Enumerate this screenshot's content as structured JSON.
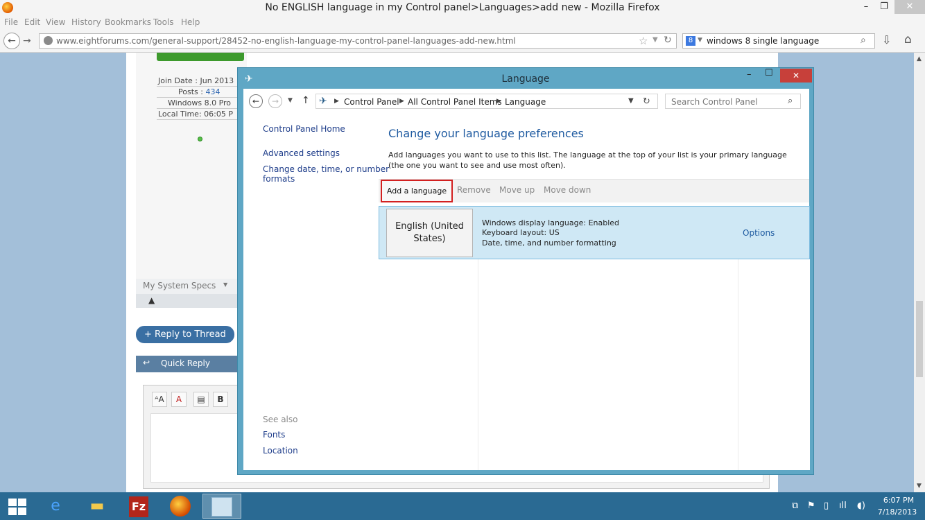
{
  "browser": {
    "title": "No ENGLISH language in my Control panel>Languages>add new - Mozilla Firefox",
    "controls": {
      "minimize": "–",
      "maximize": "❐",
      "close": "✕"
    },
    "menu": [
      "File",
      "Edit",
      "View",
      "History",
      "Bookmarks",
      "Tools",
      "Help"
    ],
    "url": "www.eightforums.com/general-support/28452-no-english-language-my-control-panel-languages-add-new.html",
    "search_query": "windows 8 single language",
    "search_engine_glyph": "8"
  },
  "page": {
    "user_info": [
      {
        "label": "Join Date",
        "value": "Jun 2013"
      },
      {
        "label": "Posts",
        "value": "434"
      },
      {
        "label": "",
        "value": "Windows 8.0 Pro"
      },
      {
        "label": "Local Time",
        "value": "06:05 P"
      }
    ],
    "system_specs": "My System Specs",
    "reply_button": "Reply to Thread",
    "quick_reply": "Quick Reply"
  },
  "cp": {
    "title": "Language",
    "breadcrumbs": [
      "Control Panel",
      "All Control Panel Items",
      "Language"
    ],
    "search_placeholder": "Search Control Panel",
    "sidebar": {
      "home": "Control Panel Home",
      "advanced": "Advanced settings",
      "change_date_1": "Change date, time, or number",
      "change_date_2": "formats",
      "see_also": "See also",
      "fonts": "Fonts",
      "location": "Location"
    },
    "heading": "Change your language preferences",
    "description": "Add languages you want to use to this list. The language at the top of your list is your primary language (the one you want to see and use most often).",
    "toolbar": {
      "add": "Add a language",
      "remove": "Remove",
      "move_up": "Move up",
      "move_down": "Move down"
    },
    "language": {
      "name_line1": "English (United",
      "name_line2": "States)",
      "details": [
        "Windows display language: Enabled",
        "Keyboard layout: US",
        "Date, time, and number formatting"
      ],
      "options": "Options"
    }
  },
  "taskbar": {
    "time": "6:07 PM",
    "date": "7/18/2013",
    "filezilla_glyph": "Fz"
  },
  "colors": {
    "window_frame": "#5fa7c5",
    "taskbar": "#2a6a93",
    "highlight_row": "#cfe8f5",
    "add_button_outline": "#d32020"
  }
}
